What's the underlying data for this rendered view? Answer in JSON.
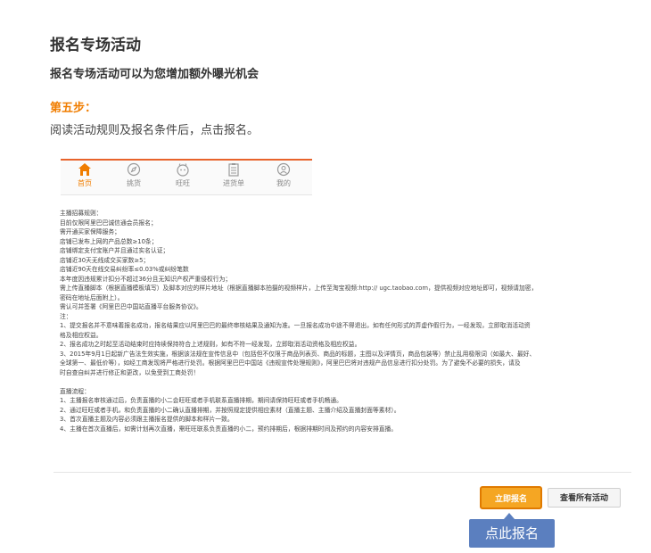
{
  "header": {
    "title": "报名专场活动",
    "subtitle": "报名专场活动可以为您增加额外曝光机会"
  },
  "step": {
    "label": "第五步：",
    "description": "阅读活动规则及报名条件后，点击报名。"
  },
  "phone_nav": {
    "active_color": "#f07d00",
    "items": [
      {
        "label": "首页",
        "icon": "home-icon"
      },
      {
        "label": "挑货",
        "icon": "compass-icon"
      },
      {
        "label": "旺旺",
        "icon": "wangwang-icon"
      },
      {
        "label": "进货单",
        "icon": "list-icon"
      },
      {
        "label": "我的",
        "icon": "user-icon"
      }
    ]
  },
  "rules": {
    "lines": [
      "主播招募规则：",
      "目前仅限阿里巴巴诚信通会员报名；",
      "需开通买家保障服务；",
      "店铺已发布上网的产品总数≥10条；",
      "店铺绑定支付宝账户并且通过实名认证；",
      "店铺近30天无线成交买家数≥5；",
      "店铺近90天在线交易纠纷率≤0.03%或纠纷笔数",
      "本年度因违规累计扣分不超过36分且无知识产权严重侵权行为；",
      "需上传直播脚本（根据直播模板填写）及脚本对应的样片地址（根据直播脚本拍摄的视频样片，上传至淘宝视频:http:// ugc.taobao.com，提供视频对应地址即可，视频请加密，",
      "密码在地址后面附上）。",
      "需认可并签署《阿里巴巴中国站直播平台服务协议》。",
      "注：",
      "1、提交报名并不意味着报名成功，报名结果应以阿里巴巴的最终审核结果及通知为准。一旦报名成功中途不得退出，如有任何形式的弄虚作假行为，一经发现，立即取消活动资",
      "格及相应权益。",
      "2、报名成功之时起至活动结束时应持续保持符合上述规则，如有不符一经发现，立即取消活动资格及相应权益。",
      "3、2015年9月1日起新广告法生效实施，根据该法规在宣传信息中（包括但不仅限于商品列表页、商品的标题，主图以及详情页，商品包装等）禁止乱用极限词（如最大、最好、",
      "全球第一、最低价等），如经工商发现将严格进行处罚。根据阿里巴巴中国站《违规宣传处理规则》，阿里巴巴将对违规产品信息进行扣分处罚。为了避免不必要的损失，请及",
      "时自查自纠并进行修正和更改，以免受到工商处罚！",
      "",
      "直播流程：",
      "1、主播报名审核通过后，负责直播的小二会旺旺或者手机联系直播排期，期间请保持旺旺或者手机畅通。",
      "2、通过旺旺或者手机，和负责直播的小二确认直播排期，并按照规定提供相应素材（直播主题、主播介绍及直播封面等素材）。",
      "3、首次直播主题及内容必须跟主播报名提供的脚本和样片一致。",
      "4、主播在首次直播后，如需计划再次直播，需旺旺联系负责直播的小二，预约排期后，根据排期时间及预约的内容安排直播。"
    ]
  },
  "actions": {
    "signup_label": "立即报名",
    "view_all_label": "查看所有活动",
    "signup_color": "#f5a623"
  },
  "callout": {
    "text": "点此报名",
    "color": "#5b7fbf"
  }
}
